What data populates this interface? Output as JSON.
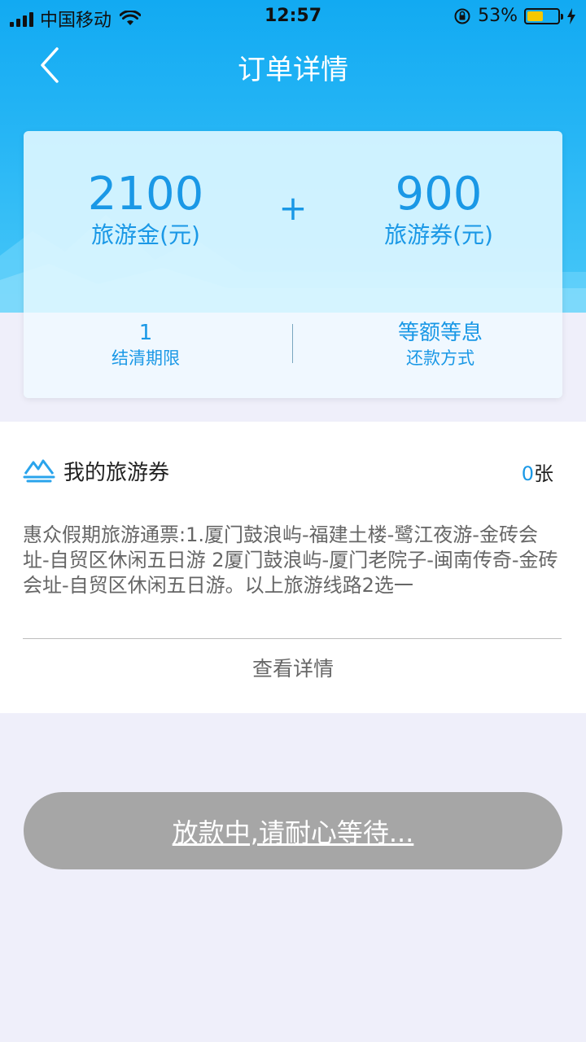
{
  "status_bar": {
    "carrier": "中国移动",
    "time": "12:57",
    "battery_percent": "53%",
    "battery_level": 0.53
  },
  "navbar": {
    "title": "订单详情",
    "back_icon": "chevron-left-icon"
  },
  "summary": {
    "travel_fund_value": "2100",
    "travel_fund_label": "旅游金(元)",
    "plus": "+",
    "travel_voucher_value": "900",
    "travel_voucher_label": "旅游券(元)",
    "term_value": "1",
    "term_label": "结清期限",
    "repayment_value": "等额等息",
    "repayment_label": "还款方式"
  },
  "voucher": {
    "icon": "mountain-icon",
    "title": "我的旅游券",
    "count": "0",
    "count_unit": "张",
    "description": "惠众假期旅游通票:1.厦门鼓浪屿-福建土楼-鹭江夜游-金砖会址-自贸区休闲五日游 2厦门鼓浪屿-厦门老院子-闽南传奇-金砖会址-自贸区休闲五日游。以上旅游线路2选一",
    "view_details": "查看详情"
  },
  "action": {
    "status_label": "放款中,请耐心等待..."
  },
  "colors": {
    "accent": "#1a98e6",
    "hero_top": "#12aaf2",
    "button_gray": "#a6a6a6"
  }
}
